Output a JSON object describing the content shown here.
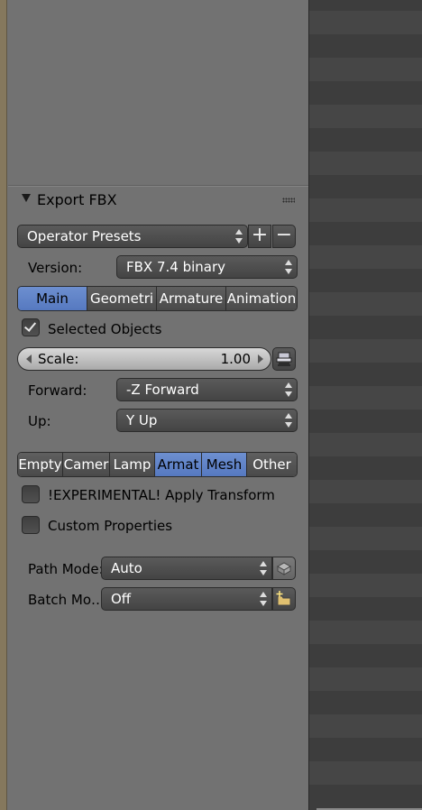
{
  "panel": {
    "title": "Export FBX",
    "operator_presets": {
      "value": "Operator Presets",
      "add_label": "+",
      "remove_label": "−"
    },
    "version": {
      "label": "Version:",
      "value": "FBX 7.4 binary"
    },
    "main_tabs": [
      {
        "label": "Main",
        "active": true
      },
      {
        "label": "Geometri",
        "active": false
      },
      {
        "label": "Armature",
        "active": false
      },
      {
        "label": "Animation",
        "active": false
      }
    ],
    "selected_objects": {
      "label": "Selected Objects",
      "checked": true
    },
    "scale": {
      "label": "Scale:",
      "value": "1.00"
    },
    "forward": {
      "label": "Forward:",
      "value": "-Z Forward"
    },
    "up": {
      "label": "Up:",
      "value": "Y Up"
    },
    "object_types": [
      {
        "label": "Empty",
        "active": false
      },
      {
        "label": "Camer",
        "active": false
      },
      {
        "label": "Lamp",
        "active": false
      },
      {
        "label": "Armat",
        "active": true
      },
      {
        "label": "Mesh",
        "active": true
      },
      {
        "label": "Other",
        "active": false
      }
    ],
    "apply_transform": {
      "label": "!EXPERIMENTAL! Apply Transform",
      "checked": false
    },
    "custom_properties": {
      "label": "Custom Properties",
      "checked": false
    },
    "path_mode": {
      "label": "Path Mode:",
      "value": "Auto"
    },
    "batch_mode": {
      "label": "Batch Mo…",
      "value": "Off"
    }
  },
  "colors": {
    "panel_bg": "#727272",
    "active_tab": "#5679c0",
    "right_area_bg": "#3d3d3d",
    "left_edge": "#85785d"
  },
  "icons": {
    "collapse": "triangle-down-icon",
    "grip": "drag-grip-icon",
    "scale_unit": "scale-settings-icon",
    "embed_textures": "package-icon",
    "new_folder": "folder-new-icon"
  }
}
